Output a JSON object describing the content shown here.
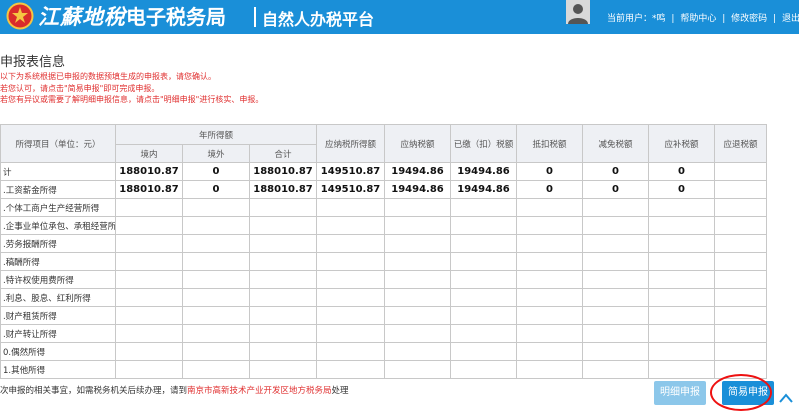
{
  "header": {
    "brand_script": "江蘇地稅",
    "brand_plain": "电子税务局",
    "platform": "自然人办税平台",
    "user_label": "当前用户：",
    "user_name": "*鸣",
    "help": "帮助中心",
    "change_password": "修改密码",
    "logout": "退出"
  },
  "page": {
    "section_title": "申报表信息",
    "notes": [
      "以下为系统根据已申报的数据预填生成的申报表，请您确认。",
      "若您认可，请点击\"简易申报\"即可完成申报。",
      "若您有异议或需要了解明细申报信息，请点击\"明细申报\"进行核实、申报。"
    ]
  },
  "table": {
    "headers": {
      "item": "所得项目（单位：元）",
      "annual_income": "年所得额",
      "domestic": "境内",
      "overseas": "境外",
      "total": "合计",
      "taxable_income": "应纳税所得额",
      "tax_payable": "应纳税额",
      "tax_paid": "已缴（扣）税额",
      "tax_credit": "抵扣税额",
      "tax_reduction": "减免税额",
      "tax_supplement": "应补税额",
      "tax_refund": "应退税额"
    },
    "rows": [
      {
        "label": "计",
        "cells": [
          "188010.87",
          "0",
          "188010.87",
          "149510.87",
          "19494.86",
          "19494.86",
          "0",
          "0",
          "0",
          ""
        ]
      },
      {
        "label": ".工资薪金所得",
        "cells": [
          "188010.87",
          "0",
          "188010.87",
          "149510.87",
          "19494.86",
          "19494.86",
          "0",
          "0",
          "0",
          ""
        ]
      },
      {
        "label": ".个体工商户生产经营所得",
        "cells": [
          "",
          "",
          "",
          "",
          "",
          "",
          "",
          "",
          "",
          ""
        ]
      },
      {
        "label": ".企事业单位承包、承租经营所得",
        "cells": [
          "",
          "",
          "",
          "",
          "",
          "",
          "",
          "",
          "",
          ""
        ]
      },
      {
        "label": ".劳务报酬所得",
        "cells": [
          "",
          "",
          "",
          "",
          "",
          "",
          "",
          "",
          "",
          ""
        ]
      },
      {
        "label": ".稿酬所得",
        "cells": [
          "",
          "",
          "",
          "",
          "",
          "",
          "",
          "",
          "",
          ""
        ]
      },
      {
        "label": ".特许权使用费所得",
        "cells": [
          "",
          "",
          "",
          "",
          "",
          "",
          "",
          "",
          "",
          ""
        ]
      },
      {
        "label": ".利息、股息、红利所得",
        "cells": [
          "",
          "",
          "",
          "",
          "",
          "",
          "",
          "",
          "",
          ""
        ]
      },
      {
        "label": ".财产租赁所得",
        "cells": [
          "",
          "",
          "",
          "",
          "",
          "",
          "",
          "",
          "",
          ""
        ]
      },
      {
        "label": ".财产转让所得",
        "cells": [
          "",
          "",
          "",
          "",
          "",
          "",
          "",
          "",
          "",
          ""
        ]
      },
      {
        "label": "0.偶然所得",
        "cells": [
          "",
          "",
          "",
          "",
          "",
          "",
          "",
          "",
          "",
          ""
        ]
      },
      {
        "label": "1.其他所得",
        "cells": [
          "",
          "",
          "",
          "",
          "",
          "",
          "",
          "",
          "",
          ""
        ]
      }
    ]
  },
  "footer": {
    "note_prefix": "次申报的相关事宜，如需税务机关后续办理，请到",
    "note_link": "南京市高新技术产业开发区地方税务局",
    "note_suffix": "处理",
    "detail_button": "明细申报",
    "simple_button": "简易申报"
  },
  "colors": {
    "header_bg": "#1a8fd8",
    "note_red": "#e03030",
    "button_primary": "#1a8fd8",
    "button_secondary": "#8cc7ea",
    "highlight": "#ee1111"
  }
}
